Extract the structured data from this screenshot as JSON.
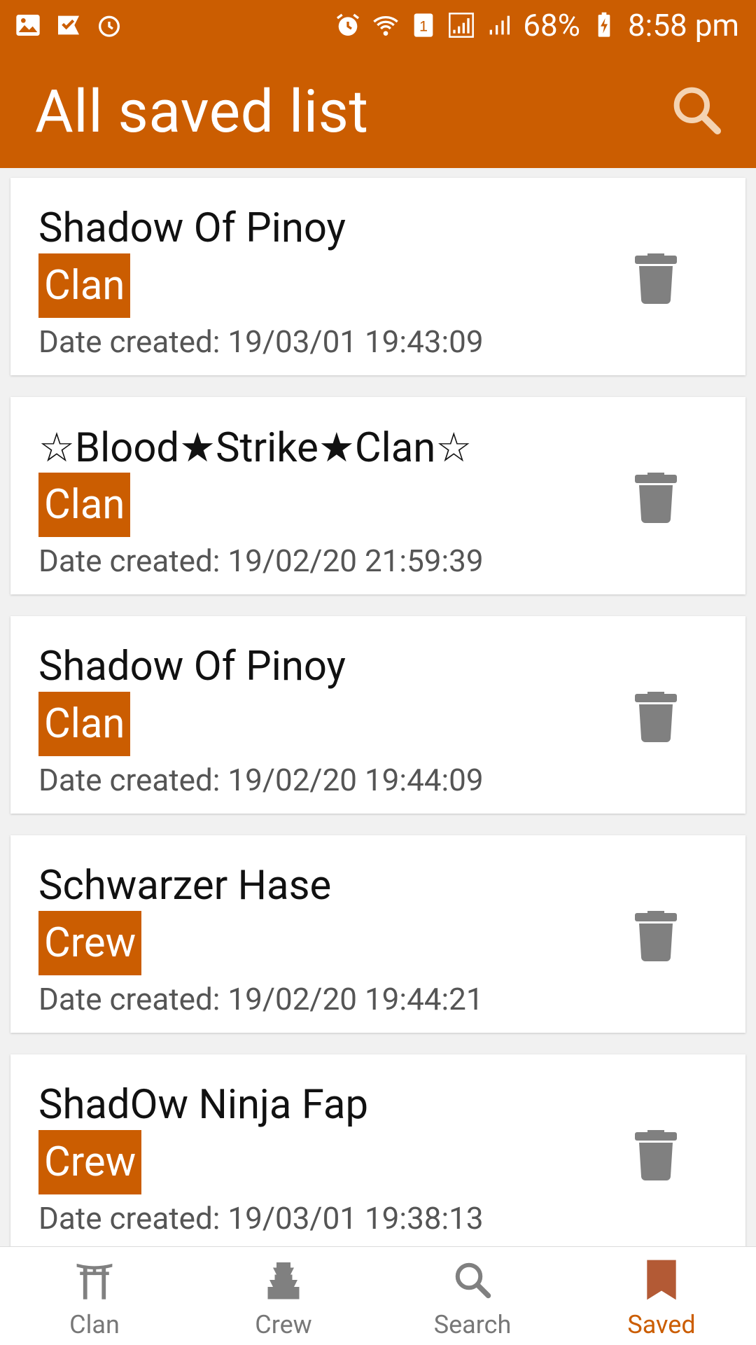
{
  "status_bar": {
    "battery": "68%",
    "time": "8:58 pm",
    "sim_slot": "1",
    "icons": [
      "gallery-icon",
      "task-check-icon",
      "alarm-outline-icon",
      "alarm-icon",
      "wifi-icon",
      "sim-icon",
      "signal-icon",
      "signal-icon-2",
      "battery-charging-icon"
    ]
  },
  "app_bar": {
    "title": "All saved list",
    "search_icon": "search-icon"
  },
  "saved_items": [
    {
      "name": "Shadow Of Pinoy",
      "type": "Clan",
      "date": "Date created: 19/03/01 19:43:09"
    },
    {
      "name": "☆Blood★Strike★Clan☆",
      "type": "Clan",
      "date": "Date created: 19/02/20 21:59:39"
    },
    {
      "name": "Shadow Of Pinoy",
      "type": "Clan",
      "date": "Date created: 19/02/20 19:44:09"
    },
    {
      "name": "Schwarzer Hase",
      "type": "Crew",
      "date": "Date created: 19/02/20 19:44:21"
    },
    {
      "name": "ShadOw Ninja Fap",
      "type": "Crew",
      "date": "Date created: 19/03/01 19:38:13"
    }
  ],
  "bottom_nav": {
    "items": [
      {
        "label": "Clan",
        "icon": "torii-gate-icon"
      },
      {
        "label": "Crew",
        "icon": "castle-icon"
      },
      {
        "label": "Search",
        "icon": "search-icon"
      },
      {
        "label": "Saved",
        "icon": "bookmark-icon"
      }
    ],
    "active": "Saved"
  },
  "colors": {
    "primary": "#cb5d01",
    "icon_gray": "#808080",
    "background": "#f1f1f1"
  }
}
